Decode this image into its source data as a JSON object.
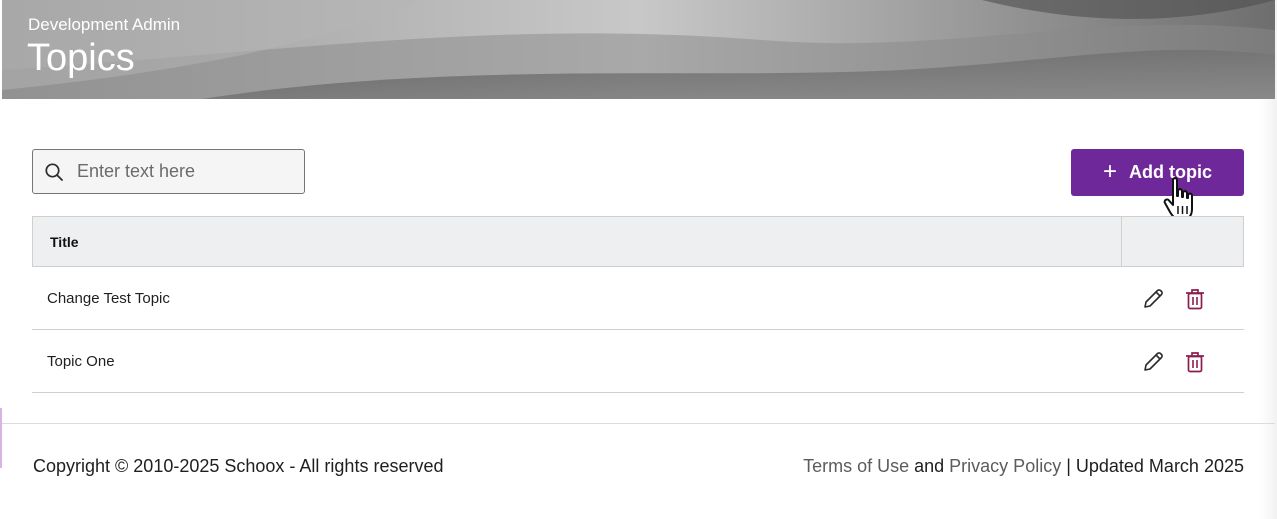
{
  "header": {
    "subtitle": "Development Admin",
    "title": "Topics"
  },
  "toolbar": {
    "search_placeholder": "Enter text here",
    "search_value": "",
    "add_plus": "+",
    "add_label": "Add topic"
  },
  "table": {
    "columns": [
      "Title",
      ""
    ],
    "rows": [
      {
        "title": "Change Test Topic"
      },
      {
        "title": "Topic One"
      }
    ]
  },
  "footer": {
    "copyright": "Copyright © 2010-2025 Schoox - All rights reserved",
    "terms_label": "Terms of Use",
    "and_text": " and ",
    "privacy_label": "Privacy Policy",
    "updated_text": " | Updated March 2025"
  },
  "colors": {
    "accent": "#6f2899",
    "delete": "#8a1f4f"
  }
}
